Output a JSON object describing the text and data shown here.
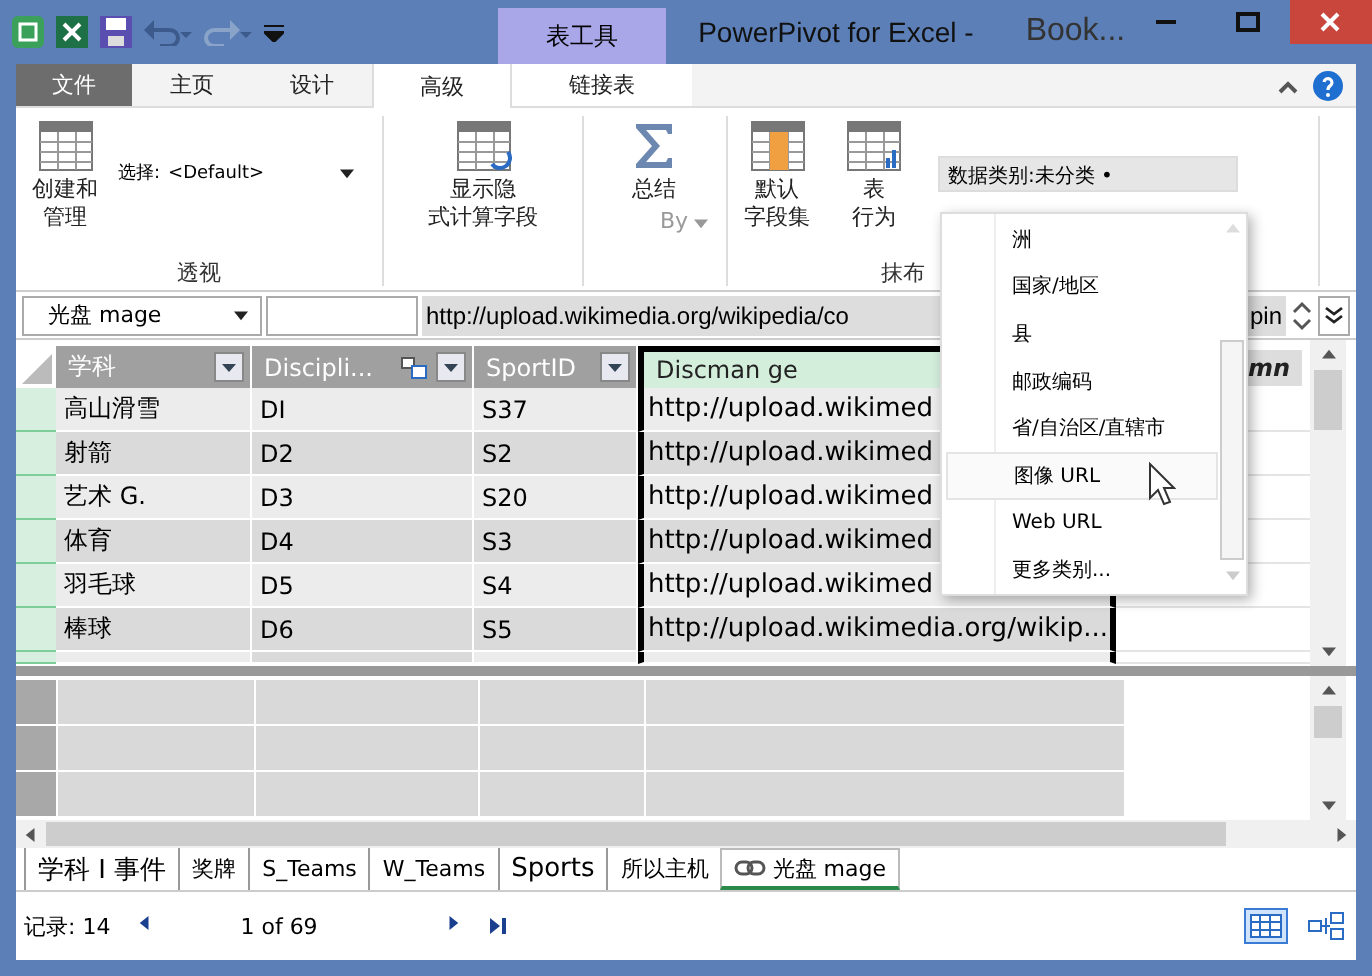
{
  "window": {
    "title": "PowerPivot for Excel -",
    "title_tail": "Book...",
    "context_tab": "表工具"
  },
  "menu_tabs": [
    {
      "label": "文件",
      "kind": "file",
      "selected": false
    },
    {
      "label": "主页",
      "kind": "tab",
      "selected": false
    },
    {
      "label": "设计",
      "kind": "tab",
      "selected": false
    },
    {
      "label": "高级",
      "kind": "tab",
      "selected": true
    },
    {
      "label": "链接表",
      "kind": "context",
      "selected": false
    }
  ],
  "ribbon": {
    "create_button": [
      "创建和",
      "管理"
    ],
    "select_label": "选择:",
    "select_value": "<Default>",
    "group_1": "透视",
    "implicit_button": [
      "显示隐",
      "式计算字段"
    ],
    "summarize_label": "总结",
    "summarize_by": "By",
    "default_fields_button": [
      "默认",
      "字段集"
    ],
    "table_behavior_button": [
      "表",
      "行为"
    ],
    "category_field": "数据类别:未分类 •",
    "group_2": "抹布"
  },
  "formula_bar": {
    "name_box": "光盘 mage",
    "formula": "http://upload.wikimedia.org/wikipedia/co",
    "formula_tail": "pin"
  },
  "table": {
    "columns": [
      {
        "label": "学科",
        "kind": "filter",
        "selected": false
      },
      {
        "label": "Discipli...",
        "kind": "filter-link",
        "selected": false
      },
      {
        "label": "SportID",
        "kind": "filter",
        "selected": false
      },
      {
        "label": "Discman ge",
        "kind": "plain",
        "selected": true
      },
      {
        "label": "mn",
        "kind": "add",
        "selected": false
      }
    ],
    "rows": [
      [
        "高山滑雪",
        "DI",
        "S37",
        "http://upload.wikimed"
      ],
      [
        "射箭",
        "D2",
        "S2",
        "http://upload.wikimed"
      ],
      [
        "艺术 G.",
        "D3",
        "S20",
        "http://upload.wikimed"
      ],
      [
        "体育",
        "D4",
        "S3",
        "http://upload.wikimed"
      ],
      [
        "羽毛球",
        "D5",
        "S4",
        "http://upload.wikimed"
      ],
      [
        "棒球",
        "D6",
        "S5",
        "http://upload.wikimedia.org/wikip..."
      ]
    ]
  },
  "category_menu": [
    {
      "label": "洲",
      "selected": false
    },
    {
      "label": "国家/地区",
      "selected": false
    },
    {
      "label": "县",
      "selected": false
    },
    {
      "label": "邮政编码",
      "selected": false
    },
    {
      "label": "省/自治区/直辖市",
      "selected": false
    },
    {
      "label": "图像 URL",
      "selected": true
    },
    {
      "label": "Web URL",
      "selected": false
    },
    {
      "label": "更多类别...",
      "selected": false
    }
  ],
  "sheet_tabs": [
    {
      "label": "学科 I 事件",
      "selected": false
    },
    {
      "label": "奖牌",
      "selected": false
    },
    {
      "label": "S_Teams",
      "selected": false
    },
    {
      "label": "W_Teams",
      "selected": false
    },
    {
      "label": "Sports",
      "selected": false
    },
    {
      "label": "所以主机",
      "selected": false
    },
    {
      "label": "光盘 mage",
      "selected": true
    }
  ],
  "status_bar": {
    "records_label": "记录:",
    "records": "14",
    "position": "1 of 69",
    "views": [
      {
        "kind": "grid",
        "selected": true
      },
      {
        "kind": "diagram",
        "selected": false
      }
    ]
  }
}
